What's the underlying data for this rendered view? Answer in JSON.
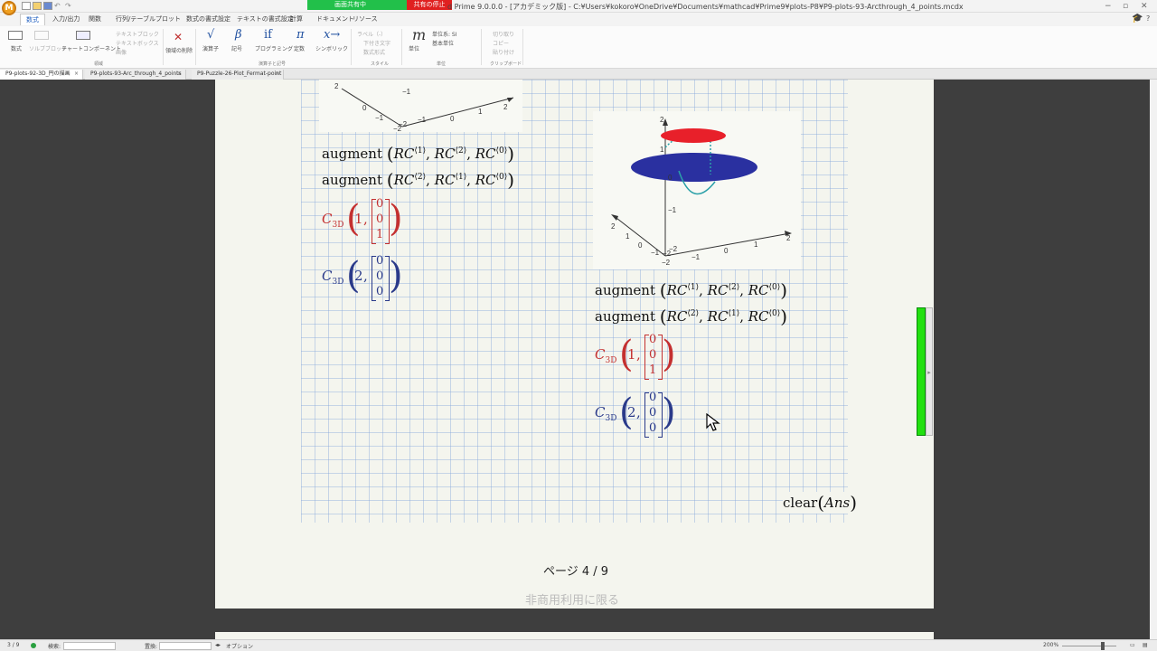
{
  "window": {
    "title": "d Prime 9.0.0.0 - [アカデミック版] - C:¥Users¥kokoro¥OneDrive¥Documents¥mathcad¥Prime9¥plots-P8¥P9-plots-93-Arcthrough_4_points.mcdx",
    "logo": "M",
    "share_label": "画面共有中",
    "share_stop": "共有の停止"
  },
  "menu": {
    "tabs": [
      "数式",
      "入力/出力",
      "関数",
      "行列/テーブル",
      "プロット",
      "数式の書式設定",
      "テキストの書式設定",
      "計算",
      "ドキュメント",
      "リソース"
    ]
  },
  "ribbon": {
    "math": "数式",
    "solve_block": "ソルブブロック",
    "chart_component": "チャートコンポーネント",
    "text_block": "テキストブロック",
    "text_box": "テキストボックス",
    "image": "画像",
    "delete_region": "領域の削除",
    "group_region": "領域",
    "operators": "演算子",
    "symbols": "記号",
    "programming": "プログラミング",
    "constants": "定数",
    "symbolic": "シンボリック",
    "group_operators": "演算子と記号",
    "label": "ラベル（-）",
    "label_text": "下付き文字",
    "math_style": "数式形式",
    "group_style": "スタイル",
    "unit": "単位",
    "unit_system": "単位系: SI",
    "base_unit": "基本単位",
    "group_units": "単位",
    "cut": "切り取り",
    "copy": "コピー",
    "paste": "貼り付け",
    "group_clipboard": "クリップボード",
    "glyph_operators": "√",
    "glyph_symbols": "β",
    "glyph_programming": "if",
    "glyph_constants": "π",
    "glyph_symbolic": "x→",
    "glyph_unit": "m"
  },
  "doc_tabs": [
    {
      "label": "P9-plots-92-3D_円の描画",
      "active": true
    },
    {
      "label": "P9-plots-93-Arc_through_4_points",
      "active": false
    },
    {
      "label": "P9-Puzzle-26-Plot_Fermat-point",
      "active": false
    }
  ],
  "doc_tab_close": "×",
  "worksheet": {
    "augment_word": "augment",
    "rc_var": "RC",
    "sup1": "⟨1⟩",
    "sup2": "⟨2⟩",
    "sup0": "⟨0⟩",
    "c_var": "C",
    "c_sub": "3D",
    "arg1": "1",
    "arg2": "2",
    "vec1": [
      "0",
      "0",
      "1"
    ],
    "vec2": [
      "0",
      "0",
      "0"
    ],
    "clear_word": "clear",
    "clear_arg": "Ans",
    "page_number": "ページ 4 / 9",
    "watermark": "非商用利用に限る"
  },
  "plot_ticks": {
    "left_plot": [
      "2",
      "1",
      "0",
      "−1",
      "−2",
      "−1",
      "0",
      "1",
      "2",
      "−2"
    ],
    "right_plot": [
      "2",
      "1",
      "0",
      "−1",
      "−2",
      "2",
      "1",
      "0",
      "−1",
      "−2",
      "−1",
      "0",
      "1",
      "2",
      "−2"
    ]
  },
  "colors": {
    "disk_red": "#e8202a",
    "disk_blue": "#2a30a0",
    "arc_teal": "#2aa0a8",
    "vector_red": "#c43030",
    "vector_blue": "#2a3a8a",
    "handle_green": "#22e010"
  },
  "status": {
    "page": "3 / 9",
    "search": "検索:",
    "replace": "置換:",
    "options": "オプション",
    "zoom": "200%"
  }
}
